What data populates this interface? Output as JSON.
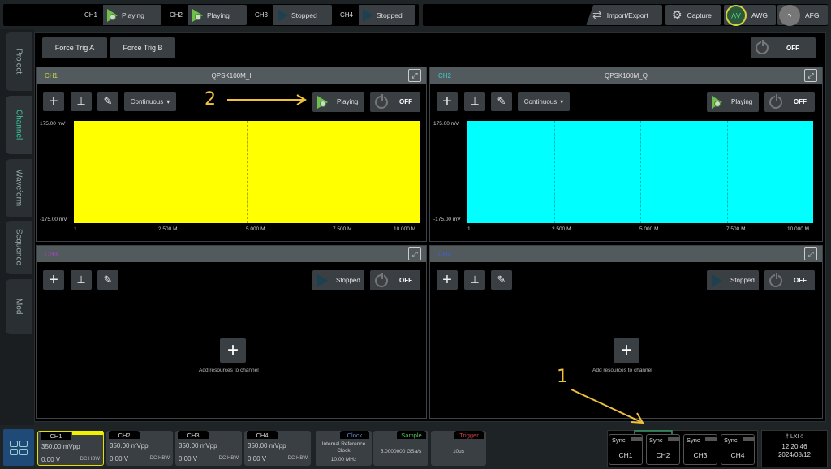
{
  "topbar": {
    "channels": [
      {
        "label": "CH1",
        "status": "Playing",
        "state": "playing"
      },
      {
        "label": "CH2",
        "status": "Playing",
        "state": "playing"
      },
      {
        "label": "CH3",
        "status": "Stopped",
        "state": "stopped"
      },
      {
        "label": "CH4",
        "status": "Stopped",
        "state": "stopped"
      }
    ],
    "import_export": "Import/Export",
    "capture": "Capture",
    "awg": "AWG",
    "afg": "AFG"
  },
  "sidebar": {
    "tabs": [
      {
        "label": "Project"
      },
      {
        "label": "Channel",
        "active": true
      },
      {
        "label": "Waveform"
      },
      {
        "label": "Sequence"
      },
      {
        "label": "Mod"
      }
    ]
  },
  "toolbar": {
    "force_trig_a": "Force Trig A",
    "force_trig_b": "Force Trig B",
    "master_output": "OFF"
  },
  "panels": [
    {
      "channel": "CH1",
      "channel_color": "#c8d84a",
      "waveform": "QPSK100M_I",
      "mode": "Continuous",
      "play_status": "Playing",
      "output": "OFF",
      "trace_color": "#ffff00",
      "y_top": "175.00 mV",
      "y_bottom": "-175.00 mV",
      "x_ticks": [
        "1",
        "2.500 M",
        "5.000 M",
        "7.500 M",
        "10.000 M"
      ]
    },
    {
      "channel": "CH2",
      "channel_color": "#3ad0d0",
      "waveform": "QPSK100M_Q",
      "mode": "Continuous",
      "play_status": "Playing",
      "output": "OFF",
      "trace_color": "#00ffff",
      "y_top": "175.00 mV",
      "y_bottom": "-175.00 mV",
      "x_ticks": [
        "1",
        "2.500 M",
        "5.000 M",
        "7.500 M",
        "10.000 M"
      ]
    },
    {
      "channel": "CH3",
      "channel_color": "#b040d0",
      "play_status": "Stopped",
      "output": "OFF",
      "add_resources": "Add resources to channel"
    },
    {
      "channel": "CH4",
      "channel_color": "#4060d0",
      "play_status": "Stopped",
      "output": "OFF",
      "add_resources": "Add resources to channel"
    }
  ],
  "bottombar": {
    "channels": [
      {
        "label": "CH1",
        "amplitude": "350.00 mVpp",
        "offset": "0.00 V",
        "coupling": "DC HBW"
      },
      {
        "label": "CH2",
        "amplitude": "350.00 mVpp",
        "offset": "0.00 V",
        "coupling": "DC HBW"
      },
      {
        "label": "CH3",
        "amplitude": "350.00 mVpp",
        "offset": "0.00 V",
        "coupling": "DC HBW"
      },
      {
        "label": "CH4",
        "amplitude": "350.00 mVpp",
        "offset": "0.00 V",
        "coupling": "DC HBW"
      }
    ],
    "clock": {
      "label": "Clock",
      "source_line1": "Internal Reference",
      "source_line2": "Clock",
      "freq": "10.00 MHz",
      "color": "#6a8ad0"
    },
    "sample": {
      "label": "Sample",
      "value": "5.0000000 GSa/s",
      "color": "#5ac060"
    },
    "trigger": {
      "label": "Trigger",
      "value": "10us",
      "color": "#d04040"
    },
    "sync": [
      {
        "label": "Sync",
        "channel": "CH1"
      },
      {
        "label": "Sync",
        "channel": "CH2"
      },
      {
        "label": "Sync",
        "channel": "CH3"
      },
      {
        "label": "Sync",
        "channel": "CH4"
      }
    ],
    "status_icons": "† LXI ◊",
    "time": "12:20:46",
    "date": "2024/08/12"
  },
  "annotations": {
    "one": "1",
    "two": "2"
  }
}
